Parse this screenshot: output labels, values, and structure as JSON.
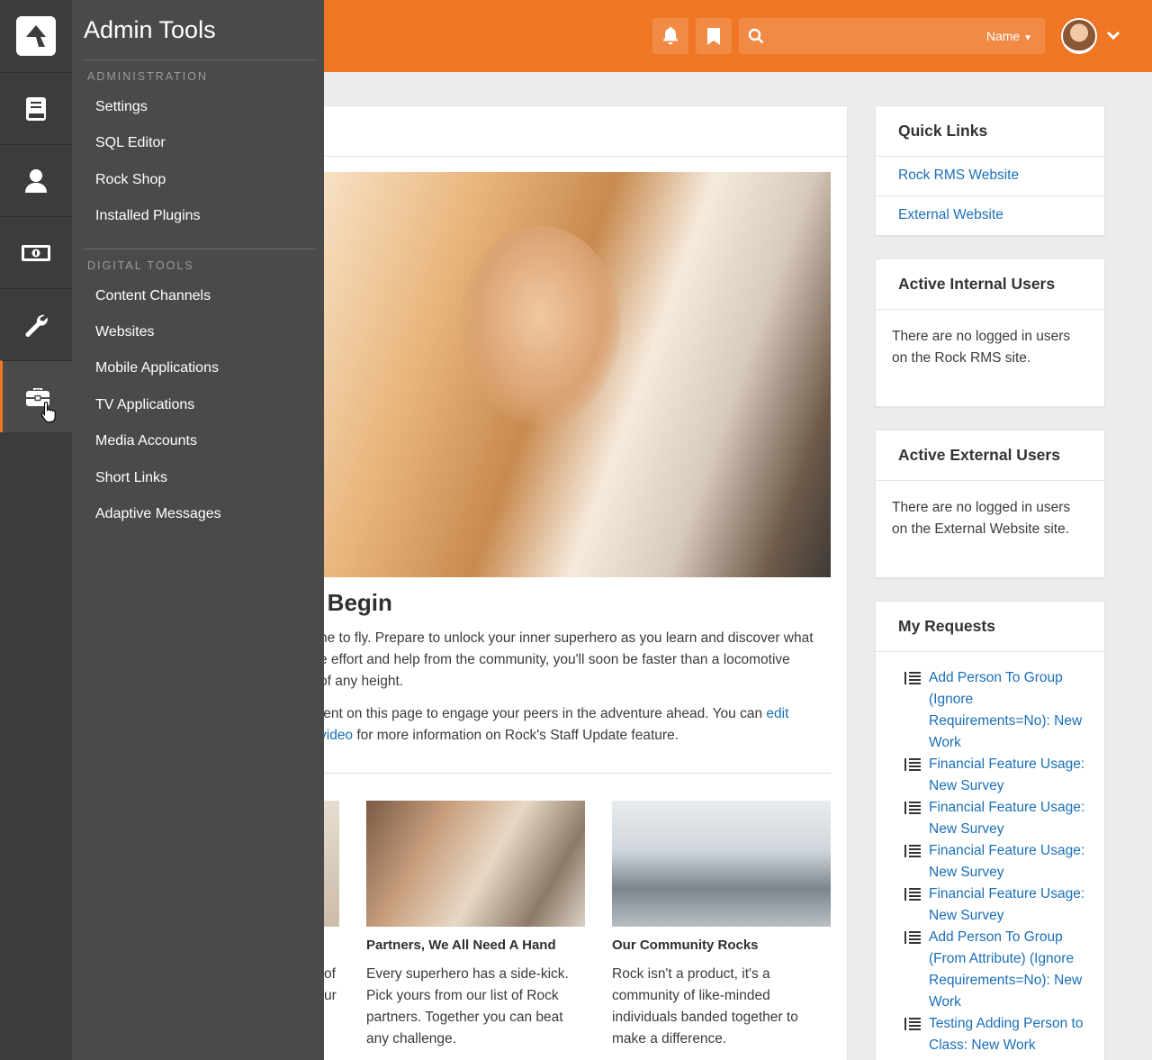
{
  "header": {
    "search_scope": "Name",
    "icons": [
      "bell-icon",
      "bookmark-icon",
      "search-icon",
      "chevron-down-icon"
    ],
    "accent_color": "#ee7625"
  },
  "rail": {
    "items": [
      "logo",
      "book-icon",
      "person-icon",
      "money-icon",
      "wrench-icon",
      "briefcase-icon"
    ],
    "active": "briefcase-icon"
  },
  "flyout": {
    "title": "Admin Tools",
    "administration": {
      "label": "ADMINISTRATION",
      "items": [
        "Settings",
        "SQL Editor",
        "Rock Shop",
        "Installed Plugins"
      ]
    },
    "digital_tools": {
      "label": "DIGITAL TOOLS",
      "items": [
        "Content Channels",
        "Websites",
        "Mobile Applications",
        "TV Applications",
        "Media Accounts",
        "Short Links",
        "Adaptive Messages"
      ]
    }
  },
  "main": {
    "hero_title": "e Begin",
    "para1": [
      "ne to fly. Prepare to unlock your inner superhero as you learn and discover what",
      "e effort and help from the community, you'll soon be faster than a locomotive",
      " of any height."
    ],
    "para2_line1": "tent on this page to engage your peers in the adventure ahead. You can ",
    "para2_link1": "edit",
    "para2_link2": "video",
    "para2_line2_rest": " for more information on Rock's Staff Update feature.",
    "features": [
      {
        "title": "",
        "text": [
          "of",
          "ur"
        ]
      },
      {
        "title": "Partners, We All Need A Hand",
        "text": [
          "Every superhero has a side-kick.",
          "Pick yours from our list of Rock",
          "partners. Together you can beat",
          "any challenge."
        ]
      },
      {
        "title": "Our Community Rocks",
        "text": [
          "Rock isn't a product, it's a",
          "community of like-minded",
          "individuals banded together to",
          "make a difference."
        ]
      }
    ]
  },
  "sidebar": {
    "quick_links": {
      "title": "Quick Links",
      "items": [
        "Rock RMS Website",
        "External Website"
      ]
    },
    "internal_users": {
      "title": "Active Internal Users",
      "text": "There are no logged in users on the Rock RMS site."
    },
    "external_users": {
      "title": "Active External Users",
      "text": "There are no logged in users on the External Website site."
    },
    "my_requests": {
      "title": "My Requests",
      "items": [
        "Add Person To Group (Ignore Requirements=No): New Work",
        "Financial Feature Usage: New Survey",
        "Financial Feature Usage: New Survey",
        "Financial Feature Usage: New Survey",
        "Financial Feature Usage: New Survey",
        "Add Person To Group (From Attribute) (Ignore Requirements=No): New Work",
        "Testing Adding Person to Class: New Work"
      ]
    }
  }
}
